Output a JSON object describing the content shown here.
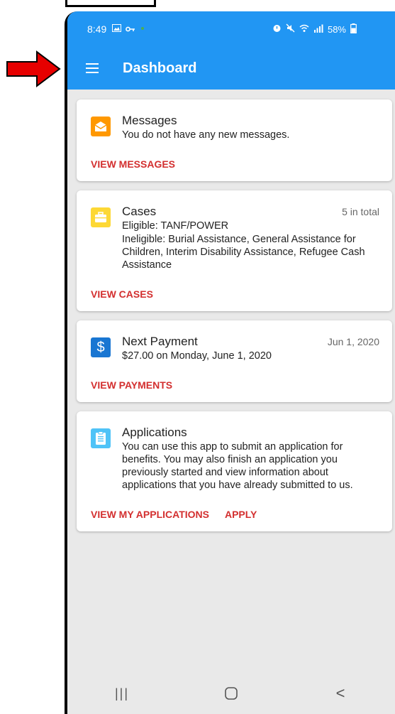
{
  "status_bar": {
    "time": "8:49",
    "battery": "58%"
  },
  "app_bar": {
    "title": "Dashboard"
  },
  "cards": {
    "messages": {
      "title": "Messages",
      "text": "You do not have any new messages.",
      "action": "VIEW MESSAGES",
      "color": "#ff9800"
    },
    "cases": {
      "title": "Cases",
      "meta": "5 in total",
      "eligible": "Eligible: TANF/POWER",
      "ineligible": "Ineligible: Burial Assistance, General Assistance for Children, Interim Disability Assistance, Refugee Cash Assistance",
      "action": "VIEW CASES",
      "color": "#fdd835"
    },
    "payment": {
      "title": "Next Payment",
      "meta": "Jun 1, 2020",
      "text": "$27.00 on Monday, June 1, 2020",
      "action": "VIEW PAYMENTS",
      "icon_glyph": "$",
      "color": "#1976d2"
    },
    "applications": {
      "title": "Applications",
      "text": "You can use this app to submit an application for benefits. You may also finish an application you previously started and view information about applications that you have already submitted to us.",
      "action_primary": "VIEW MY APPLICATIONS",
      "action_secondary": "APPLY",
      "color": "#4fc3f7"
    }
  },
  "nav_bar": {
    "recent_glyph": "|||",
    "back_glyph": "<"
  },
  "annotation": {
    "arrow_color": "#e60000"
  }
}
